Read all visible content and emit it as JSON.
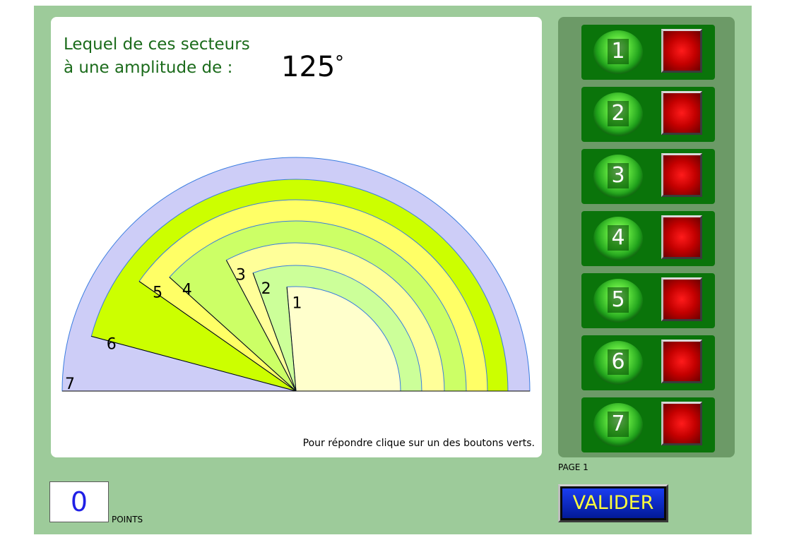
{
  "question": {
    "line1": "Lequel de ces secteurs",
    "line2": "à une amplitude de :",
    "angle": "125",
    "degree_symbol": "°"
  },
  "figure": {
    "sectors": [
      {
        "label": "7",
        "angle": 180,
        "color": "#cdcdf7"
      },
      {
        "label": "6",
        "angle": 165,
        "color": "#ccff00"
      },
      {
        "label": "5",
        "angle": 145,
        "color": "#ffff66"
      },
      {
        "label": "4",
        "angle": 138,
        "color": "#ccff66"
      },
      {
        "label": "3",
        "angle": 118,
        "color": "#ffff99"
      },
      {
        "label": "2",
        "angle": 110,
        "color": "#ccff99"
      },
      {
        "label": "1",
        "angle": 95,
        "color": "#ffffcc"
      }
    ],
    "stroke_color": "#3a7de0"
  },
  "hint": "Pour répondre clique sur un des boutons verts.",
  "choices": [
    {
      "label": "1"
    },
    {
      "label": "2"
    },
    {
      "label": "3"
    },
    {
      "label": "4"
    },
    {
      "label": "5"
    },
    {
      "label": "6"
    },
    {
      "label": "7"
    }
  ],
  "page_label": "PAGE 1",
  "validate_label": "VALIDER",
  "score": {
    "value": "0",
    "unit": "POINTS"
  }
}
